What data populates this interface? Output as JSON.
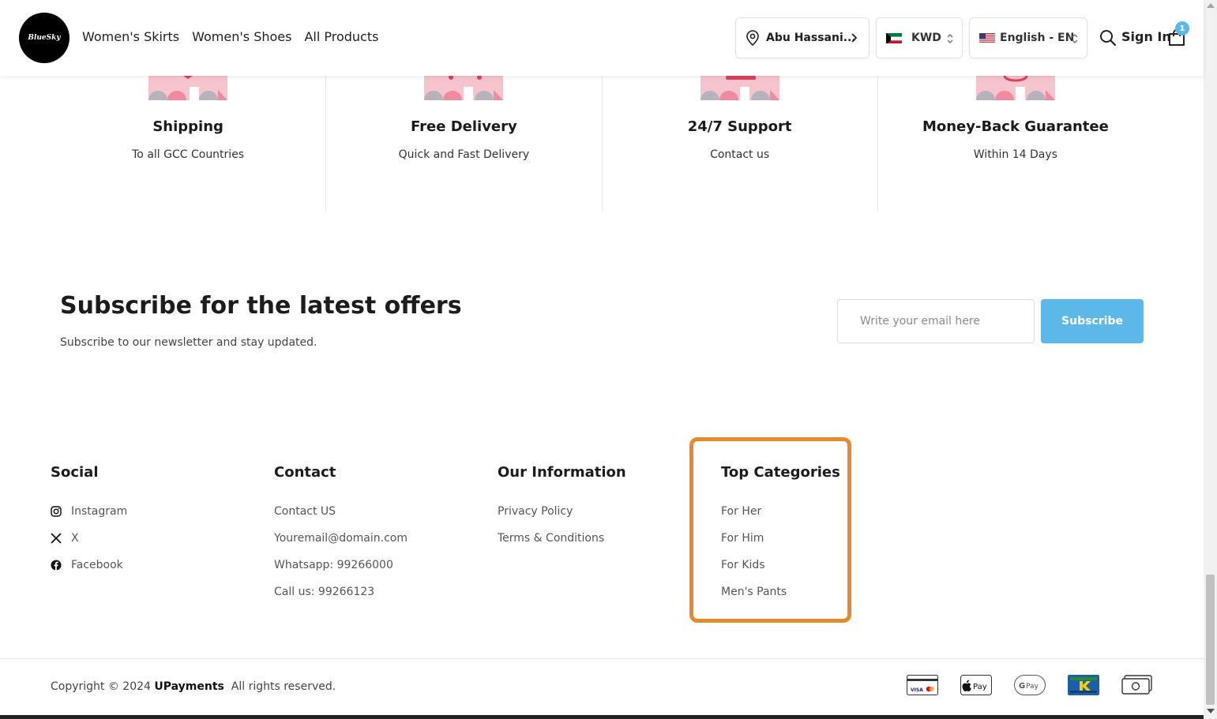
{
  "header": {
    "logo_text": "BlueSky",
    "nav": [
      "Women's Skirts",
      "Women's Shoes",
      "All Products"
    ],
    "location": "Abu Hassani...",
    "currency": "KWD",
    "language": "English - EN",
    "signin": "Sign In",
    "cart_count": "1",
    "accent": "#5bb8e8"
  },
  "features": [
    {
      "title": "Shipping",
      "subtitle": "To all GCC Countries"
    },
    {
      "title": "Free Delivery",
      "subtitle": "Quick and Fast Delivery"
    },
    {
      "title": "24/7 Support",
      "subtitle": "Contact us"
    },
    {
      "title": "Money-Back Guarantee",
      "subtitle": "Within 14 Days"
    }
  ],
  "subscribe": {
    "title": "Subscribe for the latest offers",
    "description": "Subscribe to our newsletter and stay updated.",
    "placeholder": "Write your email here",
    "button": "Subscribe"
  },
  "footer": {
    "social": {
      "title": "Social",
      "items": [
        "Instagram",
        "X",
        "Facebook"
      ]
    },
    "contact": {
      "title": "Contact",
      "items": [
        "Contact US",
        "Youremail@domain.com",
        "Whatsapp: 99266000",
        "Call us: 99266123"
      ]
    },
    "info": {
      "title": "Our Information",
      "items": [
        "Privacy Policy",
        "Terms & Conditions"
      ]
    },
    "top_categories": {
      "title": "Top Categories",
      "items": [
        "For Her",
        "For Him",
        "For Kids",
        "Men's Pants"
      ]
    },
    "highlight_color": "#e8892e"
  },
  "bottom": {
    "copyright_prefix": "Copyright © 2024",
    "brand": "UPayments",
    "rights": "All rights reserved.",
    "payment_icons": [
      "visa-mastercard-icon",
      "apple-pay-icon",
      "google-pay-icon",
      "knet-icon",
      "cash-icon"
    ]
  }
}
